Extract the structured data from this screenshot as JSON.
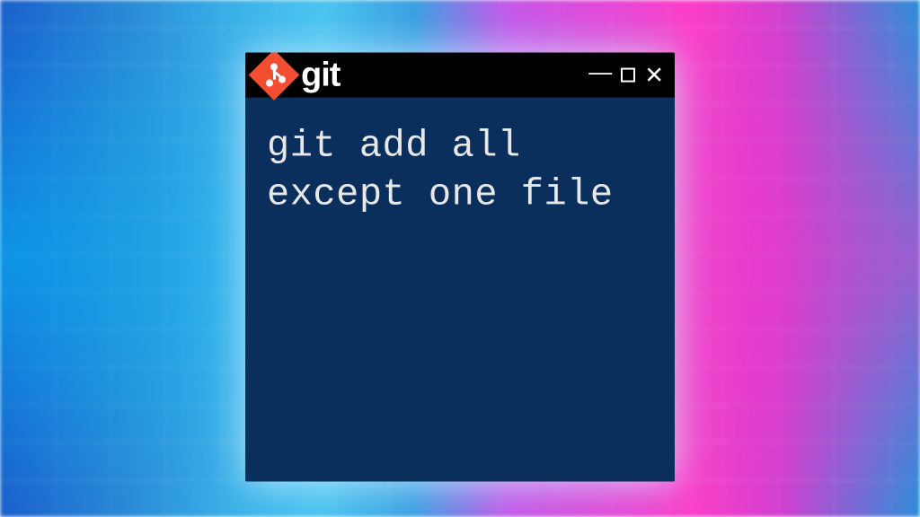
{
  "titlebar": {
    "title": "git"
  },
  "terminal": {
    "content": "git add all except one file"
  }
}
